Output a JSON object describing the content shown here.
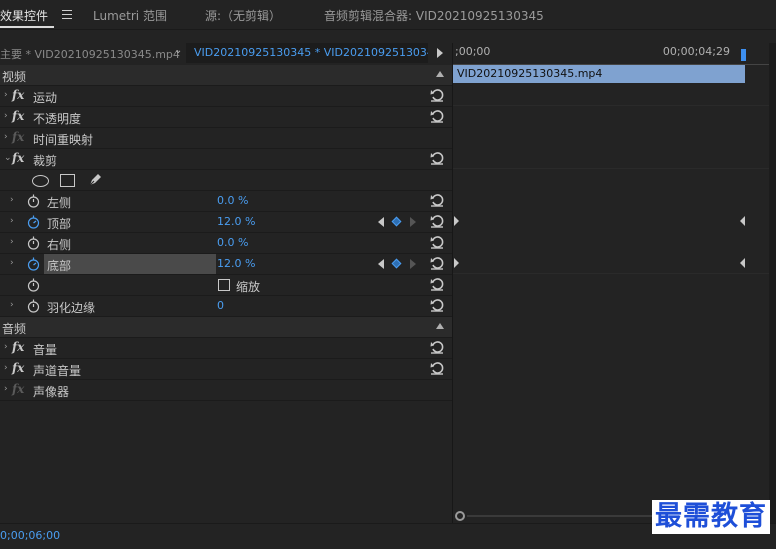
{
  "tabs": [
    {
      "label": "效果控件",
      "active": true
    },
    {
      "label": "Lumetri 范围",
      "active": false
    },
    {
      "label": "源:（无剪辑）",
      "active": false
    },
    {
      "label": "音频剪辑混合器: VID20210925130345",
      "active": false
    }
  ],
  "clip_selector": {
    "master": "主要 * VID20210925130345.mp4",
    "sequence": "VID20210925130345 * VID20210925130345..."
  },
  "timeline": {
    "start_tc": ";00;00",
    "end_tc": "00;00;04;29",
    "clip_name": "VID20210925130345.mp4"
  },
  "sections": {
    "video": "视频",
    "audio": "音频"
  },
  "effects": {
    "motion": "运动",
    "opacity": "不透明度",
    "time_remap": "时间重映射",
    "crop": "裁剪",
    "volume": "音量",
    "channel_volume": "声道音量",
    "panner": "声像器"
  },
  "crop_params": {
    "left_label": "左侧",
    "left_value": "0.0 %",
    "top_label": "顶部",
    "top_value": "12.0 %",
    "right_label": "右侧",
    "right_value": "0.0 %",
    "bottom_label": "底部",
    "bottom_value": "12.0 %",
    "zoom_label": "缩放",
    "feather_label": "羽化边缘",
    "feather_value": "0"
  },
  "footer": {
    "timecode": "0;00;06;00"
  },
  "watermark": "最需教育",
  "colors": {
    "accent_blue": "#4a9df0",
    "clip_blue": "#7fa2d0",
    "panel_bg": "#232323"
  },
  "icons": [
    "fx-icon",
    "reset-icon",
    "stopwatch-icon",
    "ellipse-mask-icon",
    "rect-mask-icon",
    "pen-mask-icon",
    "keyframe-icon",
    "hamburger-menu-icon"
  ]
}
